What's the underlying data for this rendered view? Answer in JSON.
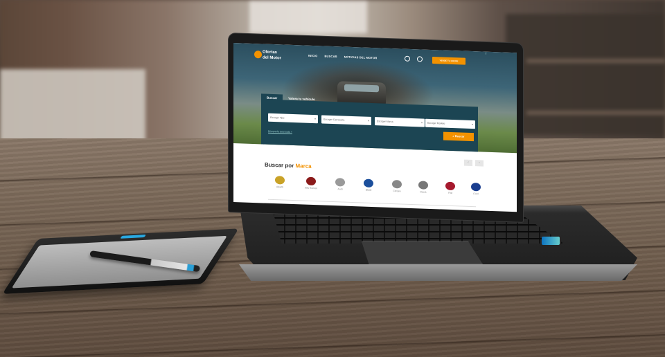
{
  "site": {
    "logo": {
      "line1": "Ofertas",
      "line2": "del Motor"
    },
    "nav": [
      "INICIO",
      "BUSCAR",
      "NOTICIAS DEL MOTOR"
    ],
    "cta_label": "VENDE TU COCHE",
    "social_label": "f"
  },
  "search_panel": {
    "tabs": [
      "Buscar",
      "Valora tu vehículo"
    ],
    "fields": [
      "Escoger Tipo",
      "Escoger Carrocería",
      "Escoger Marca",
      "Escoger Modelo"
    ],
    "advanced_link": "Búsqueda avanzada +",
    "submit_label": "Buscar",
    "submit_icon": "search-icon"
  },
  "brands": {
    "title_prefix": "Buscar por",
    "title_accent": "Marca",
    "prev": "‹",
    "next": "›",
    "items": [
      {
        "name": "Abarth",
        "color": "#c9a227"
      },
      {
        "name": "Alfa Romeo",
        "color": "#8b1a1a"
      },
      {
        "name": "Audi",
        "color": "#9a9a9a"
      },
      {
        "name": "BMW",
        "color": "#1c4f9c"
      },
      {
        "name": "Citroen",
        "color": "#888888"
      },
      {
        "name": "Dacia",
        "color": "#777777"
      },
      {
        "name": "Fiat",
        "color": "#a6192e"
      },
      {
        "name": "Ford",
        "color": "#1a3d8f"
      }
    ]
  },
  "colors": {
    "accent": "#f39200",
    "panel": "#1c4553"
  }
}
